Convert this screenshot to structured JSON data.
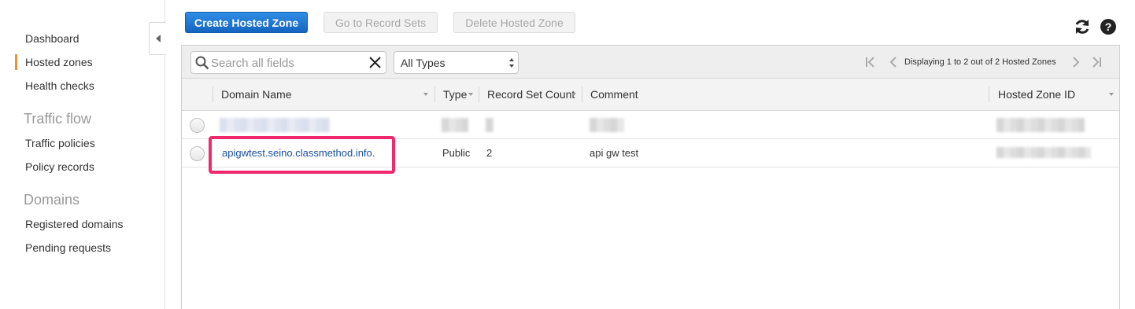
{
  "sidebar": {
    "items": [
      {
        "label": "Dashboard"
      },
      {
        "label": "Hosted zones"
      },
      {
        "label": "Health checks"
      },
      {
        "label": "Traffic policies"
      },
      {
        "label": "Policy records"
      },
      {
        "label": "Registered domains"
      },
      {
        "label": "Pending requests"
      }
    ],
    "sections": {
      "traffic_flow": "Traffic flow",
      "domains": "Domains"
    },
    "active": "Hosted zones"
  },
  "toolbar": {
    "create_label": "Create Hosted Zone",
    "goto_label": "Go to Record Sets",
    "delete_label": "Delete Hosted Zone"
  },
  "filters": {
    "search_placeholder": "Search all fields",
    "type_value": "All Types"
  },
  "pager": {
    "text": "Displaying 1 to 2 out of 2 Hosted Zones"
  },
  "table": {
    "columns": [
      "Domain Name",
      "Type",
      "Record Set Count",
      "Comment",
      "Hosted Zone ID"
    ],
    "rows": [
      {
        "domain": "",
        "type": "",
        "count": "",
        "comment": "",
        "zone_id": "",
        "redacted": true
      },
      {
        "domain": "apigwtest.seino.classmethod.info.",
        "type": "Public",
        "count": "2",
        "comment": "api gw test",
        "zone_id": "",
        "redacted": false
      }
    ]
  },
  "colors": {
    "accent": "#e8952f",
    "primary_button": "#1f78d1",
    "highlight": "#f0296d",
    "link": "#1a4fa0"
  },
  "icons": {
    "refresh": "refresh-icon",
    "help": "help-icon",
    "search": "search-icon",
    "clear": "clear-icon"
  }
}
